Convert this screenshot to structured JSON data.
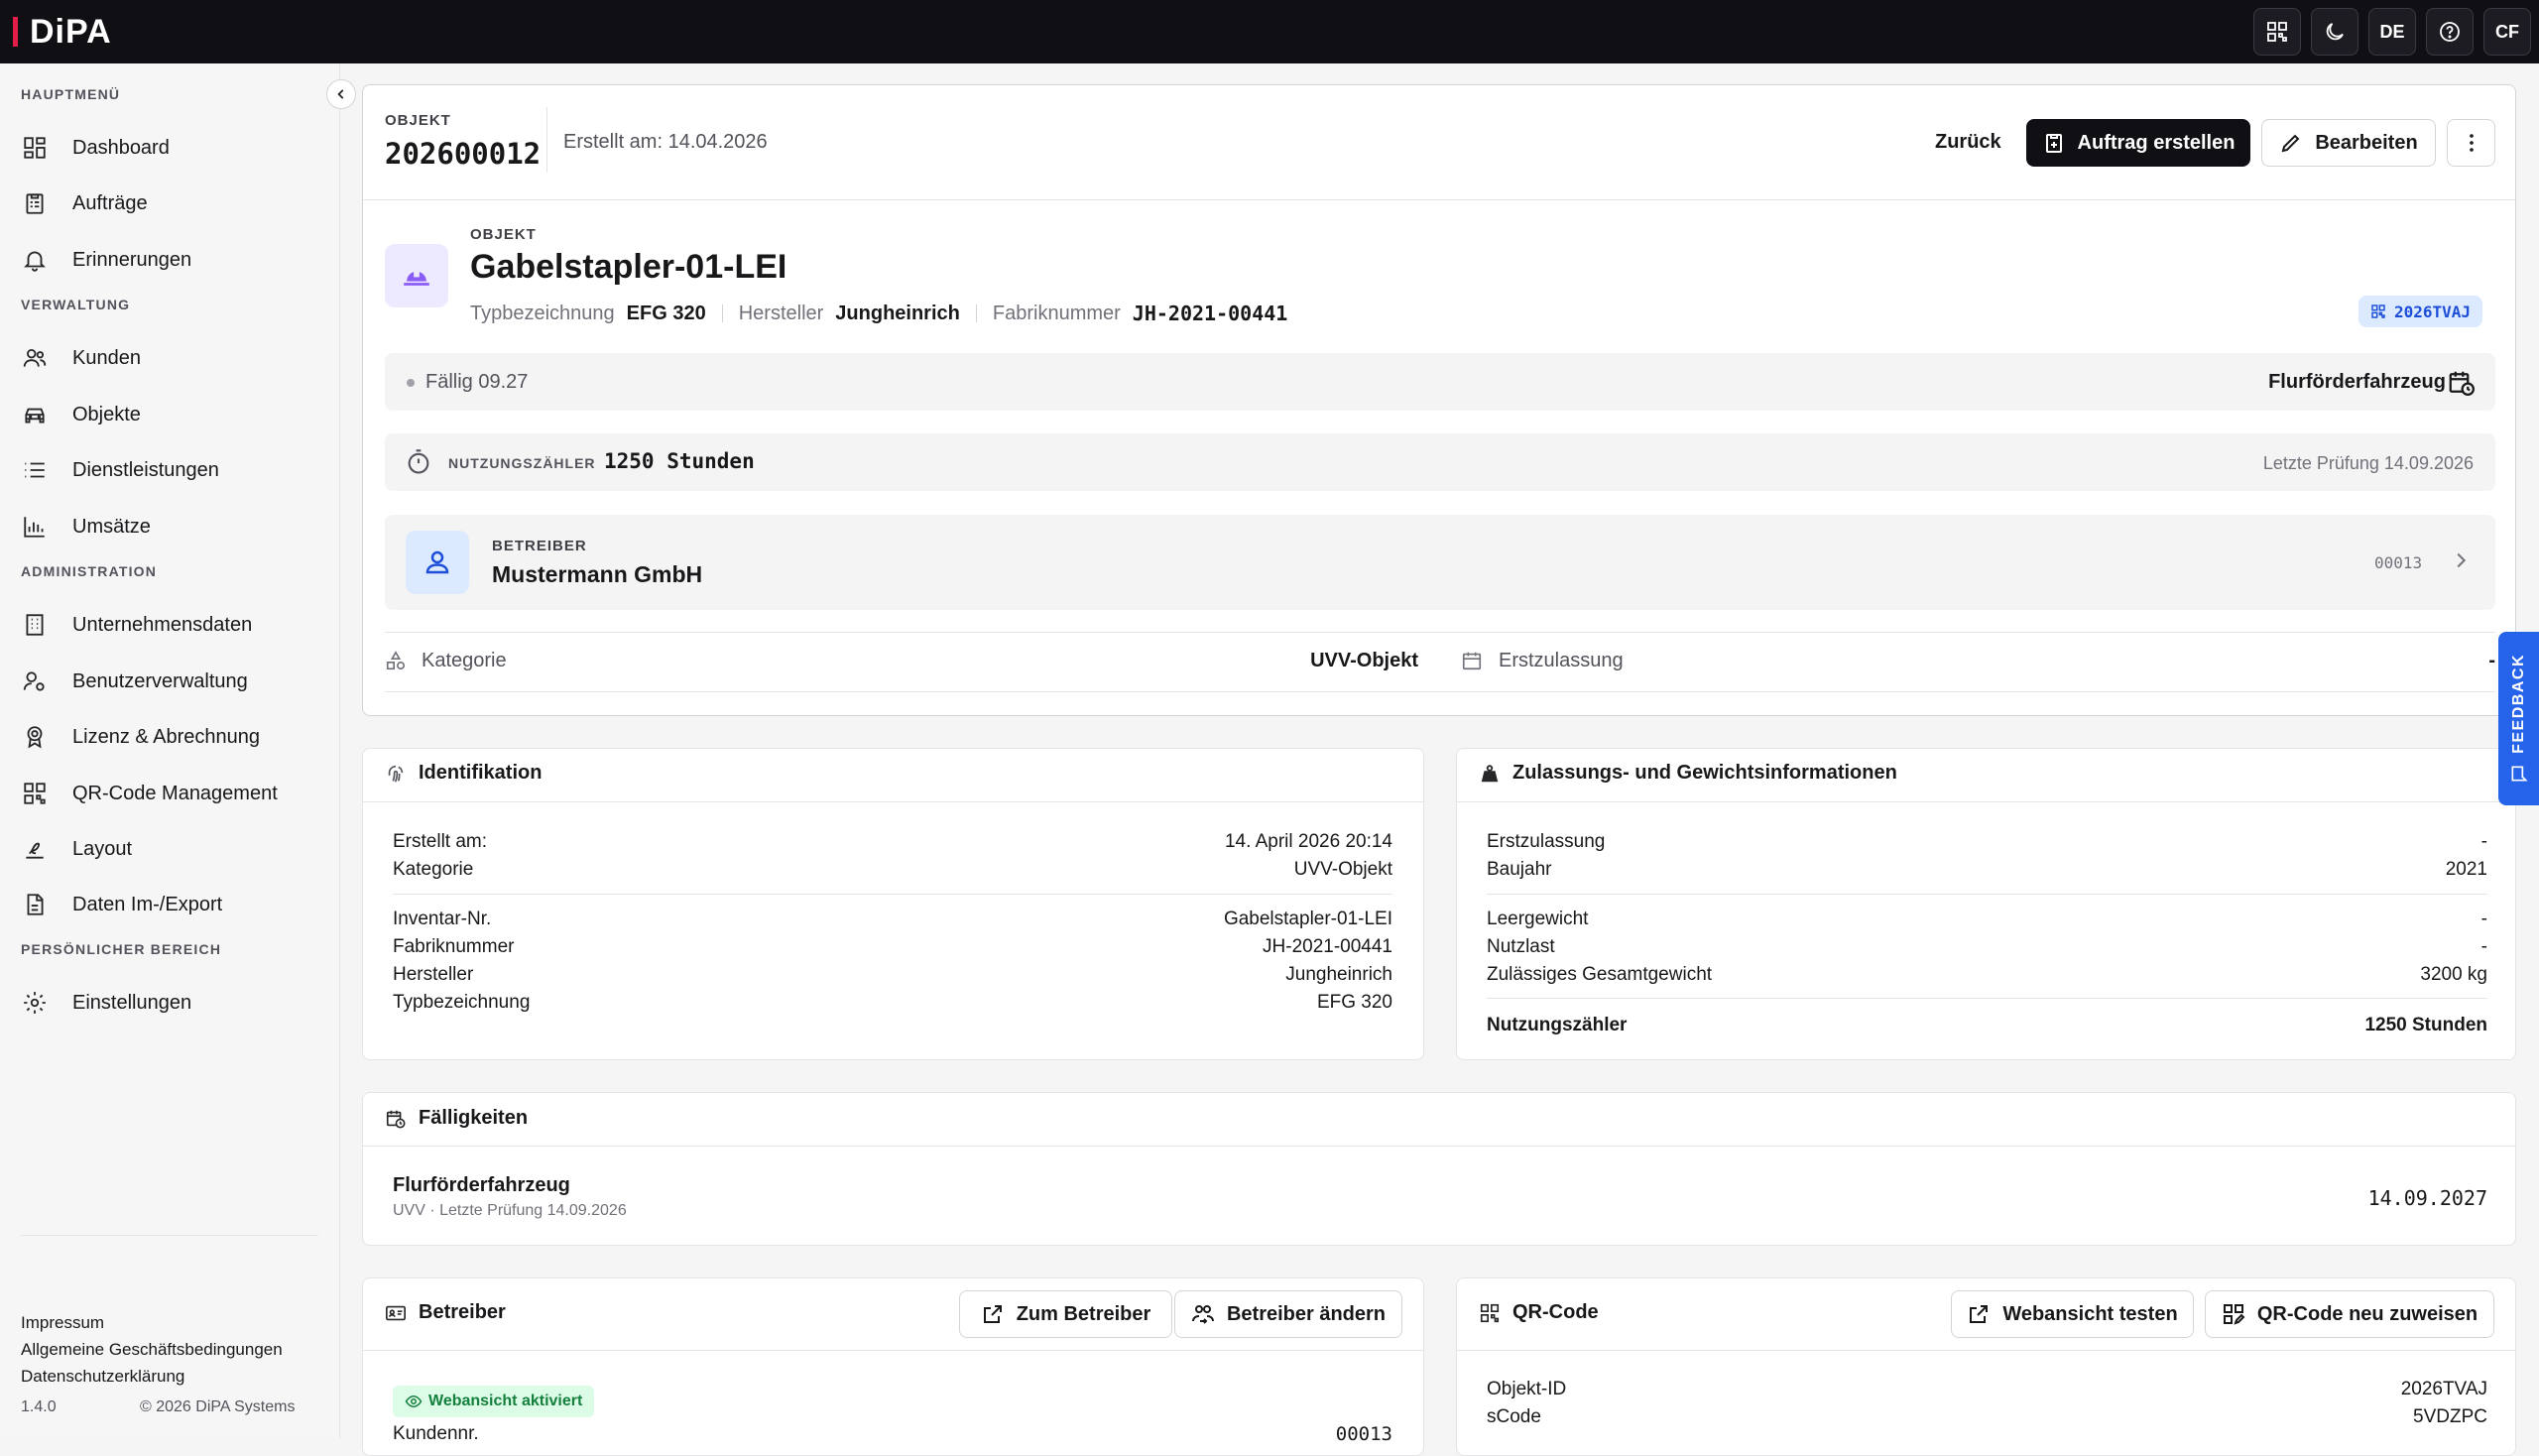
{
  "app": {
    "logo": "DiPA",
    "lang": "DE",
    "user_initials": "CF"
  },
  "sidebar": {
    "sections": {
      "main": "HAUPTMENÜ",
      "admin_mgmt": "VERWALTUNG",
      "administration": "ADMINISTRATION",
      "personal": "PERSÖNLICHER BEREICH"
    },
    "items": [
      {
        "label": "Dashboard",
        "icon": "dashboard-icon"
      },
      {
        "label": "Aufträge",
        "icon": "clipboard-icon"
      },
      {
        "label": "Erinnerungen",
        "icon": "bell-icon"
      },
      {
        "label": "Kunden",
        "icon": "users-icon"
      },
      {
        "label": "Objekte",
        "icon": "car-icon"
      },
      {
        "label": "Dienstleistungen",
        "icon": "list-icon"
      },
      {
        "label": "Umsätze",
        "icon": "bar-chart-icon"
      },
      {
        "label": "Unternehmensdaten",
        "icon": "building-icon"
      },
      {
        "label": "Benutzerverwaltung",
        "icon": "user-cog-icon"
      },
      {
        "label": "Lizenz & Abrechnung",
        "icon": "badge-icon"
      },
      {
        "label": "QR-Code Management",
        "icon": "qr-icon"
      },
      {
        "label": "Layout",
        "icon": "signature-icon"
      },
      {
        "label": "Daten Im-/Export",
        "icon": "file-icon"
      },
      {
        "label": "Einstellungen",
        "icon": "gear-icon"
      }
    ],
    "footer": {
      "impressum": "Impressum",
      "agb": "Allgemeine Geschäftsbedingungen",
      "privacy": "Datenschutzerklärung",
      "version": "1.4.0",
      "copyright": "© 2026 DiPA Systems"
    }
  },
  "header": {
    "label": "OBJEKT",
    "number": "202600012",
    "created": "Erstellt am: 14.04.2026",
    "back": "Zurück",
    "create_order": "Auftrag erstellen",
    "edit": "Bearbeiten"
  },
  "object": {
    "label": "OBJEKT",
    "name": "Gabelstapler-01-LEI",
    "type_label": "Typbezeichnung",
    "type_value": "EFG 320",
    "manufacturer_label": "Hersteller",
    "manufacturer_value": "Jungheinrich",
    "serial_label": "Fabriknummer",
    "serial_value": "JH-2021-00441",
    "qr_badge": "2026TVAJ",
    "due_text": "Fällig 09.27",
    "category_right": "Flurförderfahrzeug",
    "counter_label": "NUTZUNGSZÄHLER",
    "counter_value": "1250 Stunden",
    "last_check": "Letzte Prüfung 14.09.2026",
    "operator_label": "BETREIBER",
    "operator_name": "Mustermann GmbH",
    "operator_id": "00013",
    "category_label": "Kategorie",
    "category_value": "UVV-Objekt",
    "first_reg_label": "Erstzulassung",
    "first_reg_value": "-"
  },
  "identification": {
    "title": "Identifikation",
    "rows": [
      {
        "k": "Erstellt am:",
        "v": "14. April 2026 20:14"
      },
      {
        "k": "Kategorie",
        "v": "UVV-Objekt"
      },
      {
        "k": "Inventar-Nr.",
        "v": "Gabelstapler-01-LEI"
      },
      {
        "k": "Fabriknummer",
        "v": "JH-2021-00441"
      },
      {
        "k": "Hersteller",
        "v": "Jungheinrich"
      },
      {
        "k": "Typbezeichnung",
        "v": "EFG 320"
      }
    ]
  },
  "approval": {
    "title": "Zulassungs- und Gewichtsinformationen",
    "rows": [
      {
        "k": "Erstzulassung",
        "v": "-"
      },
      {
        "k": "Baujahr",
        "v": "2021"
      },
      {
        "k": "Leergewicht",
        "v": "-"
      },
      {
        "k": "Nutzlast",
        "v": "-"
      },
      {
        "k": "Zulässiges Gesamtgewicht",
        "v": "3200 kg"
      },
      {
        "k": "Nutzungszähler",
        "v": "1250 Stunden"
      }
    ]
  },
  "due": {
    "title": "Fälligkeiten",
    "item_title": "Flurförderfahrzeug",
    "item_sub": "UVV · Letzte Prüfung 14.09.2026",
    "item_date": "14.09.2027"
  },
  "operator_card": {
    "title": "Betreiber",
    "to_operator": "Zum Betreiber",
    "change_operator": "Betreiber ändern",
    "web_badge": "Webansicht aktiviert",
    "customer_no_label": "Kundennr.",
    "customer_no_value": "00013"
  },
  "qr_card": {
    "title": "QR-Code",
    "test_web": "Webansicht testen",
    "reassign": "QR-Code neu zuweisen",
    "rows": [
      {
        "k": "Objekt-ID",
        "v": "2026TVAJ"
      },
      {
        "k": "sCode",
        "v": "5VDZPC"
      }
    ]
  },
  "feedback": "FEEDBACK"
}
